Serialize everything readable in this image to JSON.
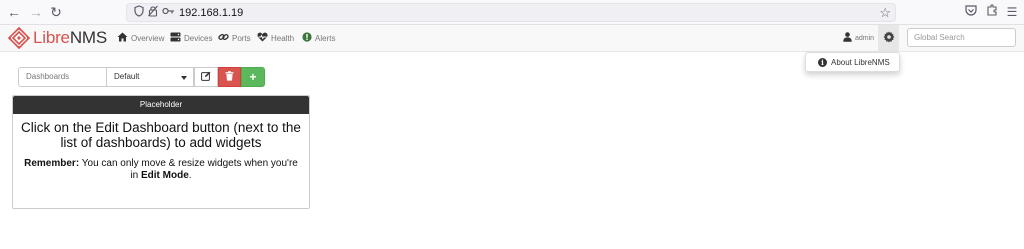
{
  "browser": {
    "url": "192.168.1.19"
  },
  "navbar": {
    "brand_libre": "Libre",
    "brand_nms": "NMS",
    "items": [
      {
        "label": "Overview",
        "icon": "home-icon"
      },
      {
        "label": "Devices",
        "icon": "server-icon"
      },
      {
        "label": "Ports",
        "icon": "link-icon"
      },
      {
        "label": "Health",
        "icon": "heartbeat-icon"
      },
      {
        "label": "Alerts",
        "icon": "alert-icon"
      }
    ],
    "user": "admin",
    "search_placeholder": "Global Search"
  },
  "dropdown": {
    "about": "About LibreNMS"
  },
  "dashboard": {
    "label": "Dashboards",
    "selected": "Default"
  },
  "widget": {
    "title": "Placeholder",
    "message": "Click on the Edit Dashboard button (next to the list of dashboards) to add widgets",
    "note_bold": "Remember:",
    "note_text": " You can only move & resize widgets when you're in ",
    "note_mode": "Edit Mode",
    "note_end": "."
  },
  "colors": {
    "brand_red": "#d9534f",
    "danger": "#d9534f",
    "success": "#5cb85c",
    "widget_header": "#333333"
  }
}
